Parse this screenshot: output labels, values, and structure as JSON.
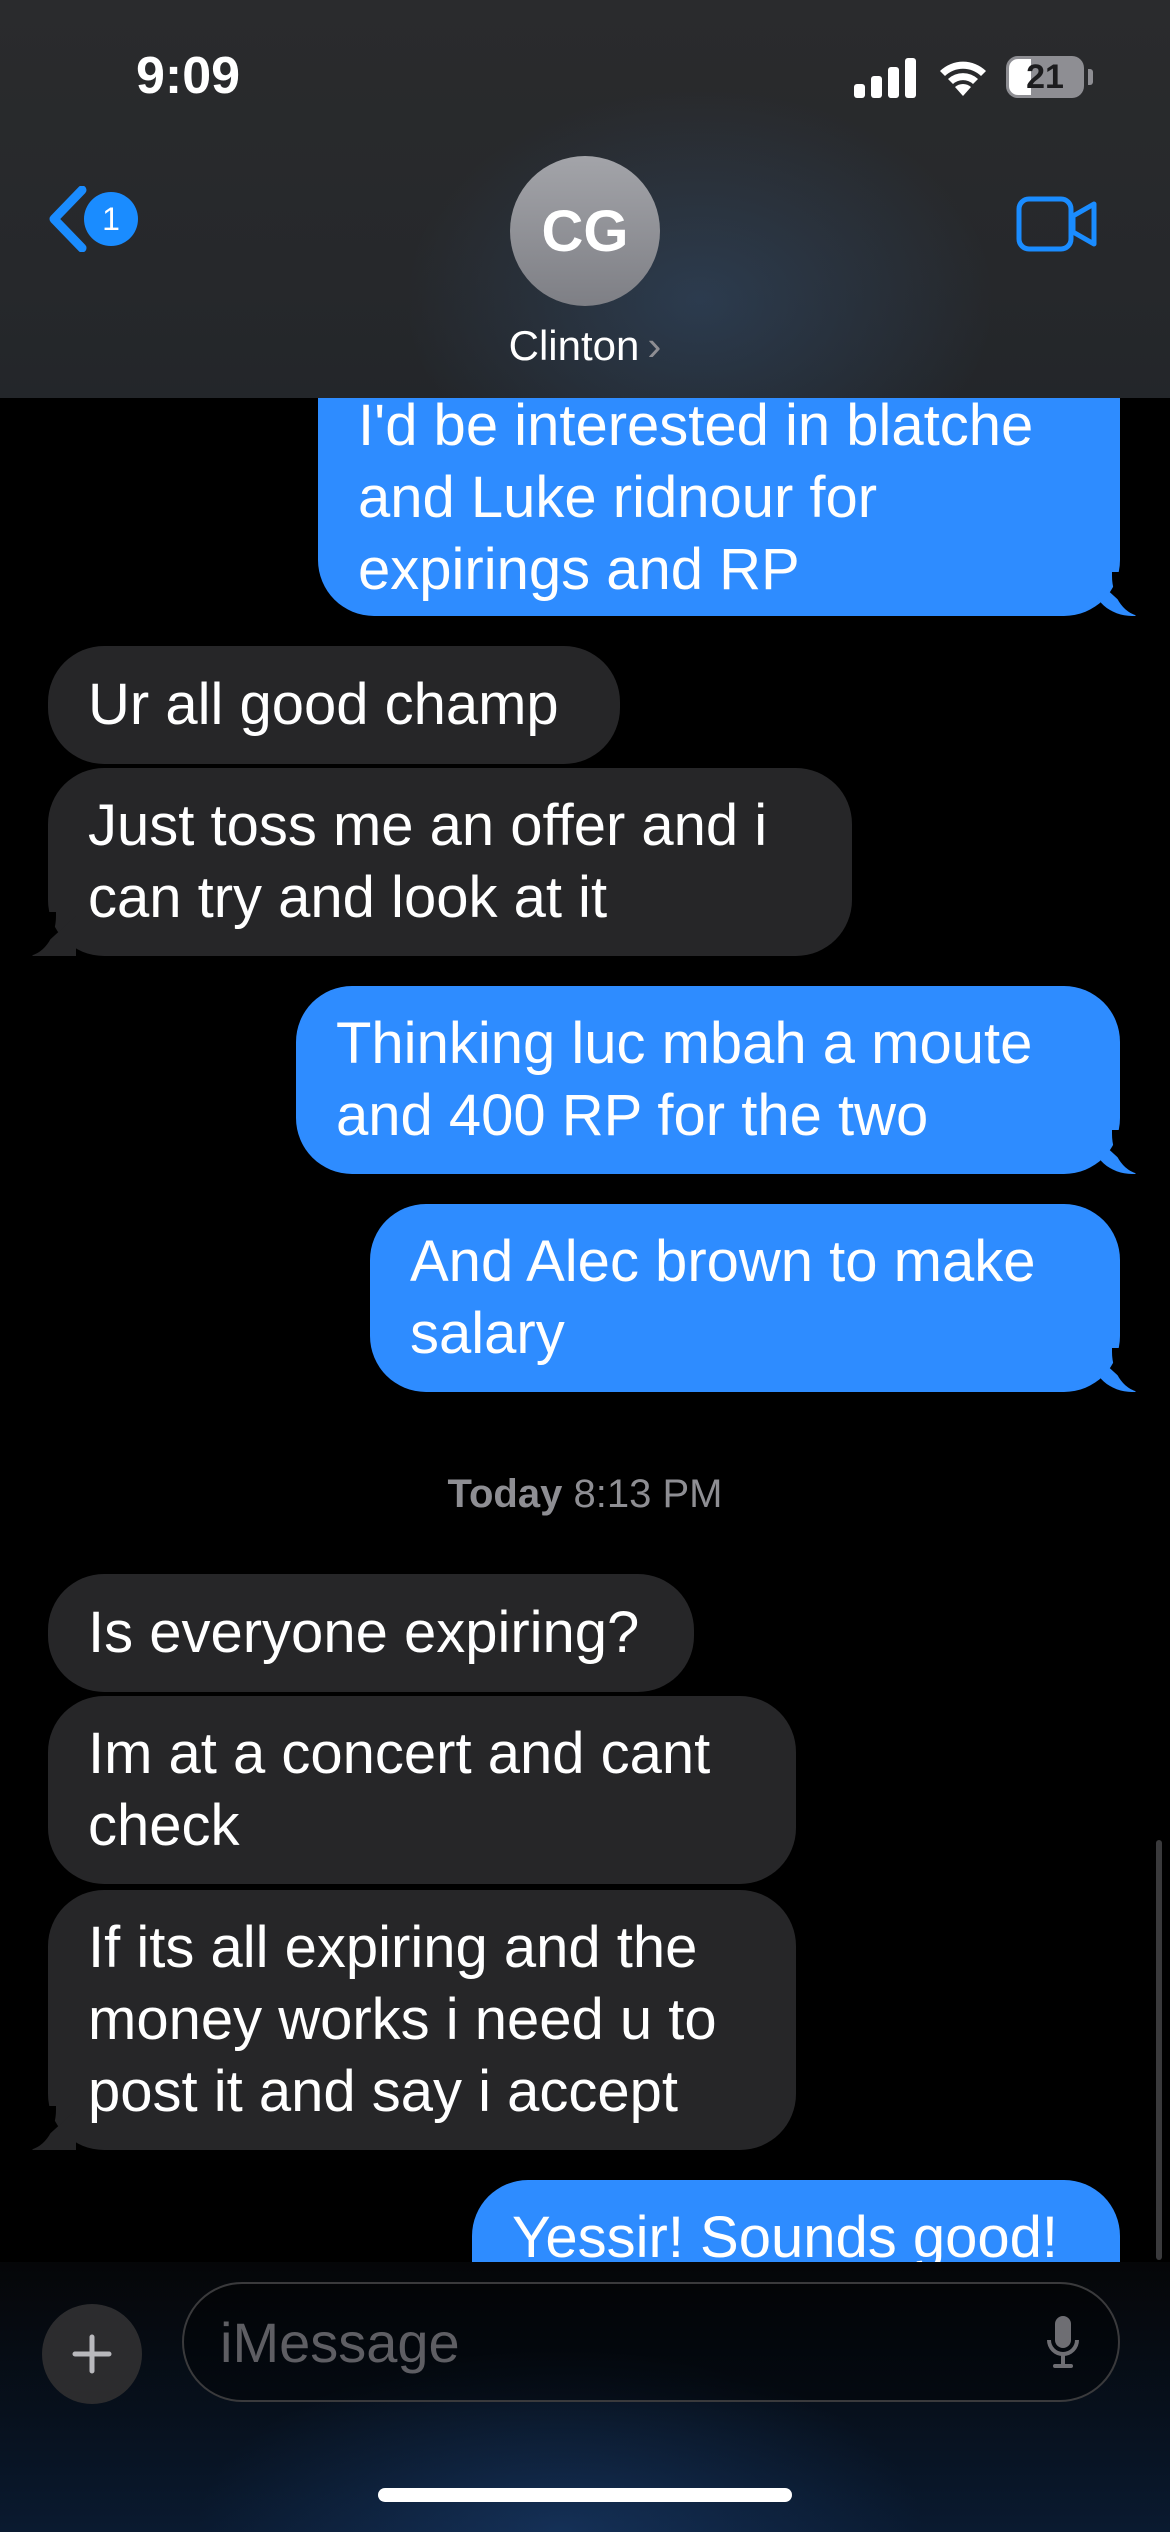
{
  "status_bar": {
    "time": "9:09",
    "battery": "21"
  },
  "header": {
    "back_badge": "1",
    "avatar_initials": "CG",
    "contact_name": "Clinton",
    "chevron": "›",
    "icons": {
      "back": "chevron-left-icon",
      "video": "video-camera-icon"
    },
    "accent_color": "#1a8cff"
  },
  "messages": [
    {
      "direction": "outgoing",
      "text": "I'd be interested in blatche\nand Luke ridnour for\nexpirings and RP"
    },
    {
      "direction": "incoming",
      "text": "Ur all good champ"
    },
    {
      "direction": "incoming",
      "text": "Just toss me an offer and i\ncan try and look at it"
    },
    {
      "direction": "outgoing",
      "text": "Thinking luc mbah a moute\nand 400 RP for the two"
    },
    {
      "direction": "outgoing",
      "text": "And Alec brown to make\nsalary"
    },
    {
      "direction": "incoming",
      "text": "Is everyone expiring?"
    },
    {
      "direction": "incoming",
      "text": "Im at a concert and cant\ncheck"
    },
    {
      "direction": "incoming",
      "text": "If its all expiring and the\nmoney works i need u to\npost it and say i accept"
    },
    {
      "direction": "outgoing",
      "text": "Yessir! Sounds good!"
    }
  ],
  "timestamp": {
    "day": "Today",
    "time": "8:13 PM"
  },
  "compose": {
    "placeholder": "iMessage",
    "icons": {
      "plus": "plus-icon",
      "mic": "microphone-icon"
    }
  },
  "colors": {
    "outgoing": "#2e8cff",
    "incoming": "#262628",
    "background": "#000000"
  }
}
